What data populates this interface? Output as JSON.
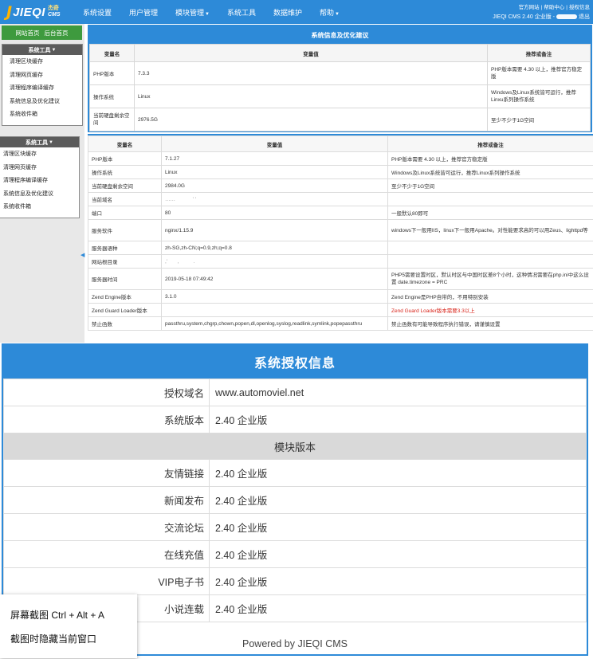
{
  "header": {
    "logo": {
      "letter": "J",
      "name": "JIEQI",
      "sub_cn": "杰奇",
      "sub_en": "CMS"
    },
    "nav": [
      {
        "label": "系统设置",
        "dropdown": false
      },
      {
        "label": "用户管理",
        "dropdown": false
      },
      {
        "label": "模块管理",
        "dropdown": true
      },
      {
        "label": "系统工具",
        "dropdown": false
      },
      {
        "label": "数据维护",
        "dropdown": false
      },
      {
        "label": "帮助",
        "dropdown": true
      }
    ],
    "top_links": [
      "官方网站",
      "帮助中心",
      "授权信息"
    ],
    "version_text": "JIEQI CMS 2.40 企业版 -",
    "logout": "退出"
  },
  "sidebar": {
    "home_links": [
      "网站首页",
      "后台首页"
    ],
    "panel_title": "系统工具",
    "items": [
      "清理区块缓存",
      "清理网页缓存",
      "清理程序编译缓存",
      "系统信息及优化建议",
      "系统收件箱"
    ],
    "panel2_title": "系统工具",
    "items2": [
      "清理区块缓存",
      "清理网页缓存",
      "清理程序编译缓存",
      "系统信息及优化建议",
      "系统收件箱"
    ]
  },
  "table1": {
    "title": "系统信息及优化建议",
    "headers": [
      "变量名",
      "变量值",
      "推荐或备注"
    ],
    "rows": [
      {
        "name": "PHP版本",
        "value": "7.3.3",
        "note": "PHP版本需要 4.30 以上，推荐官方稳定版"
      },
      {
        "name": "操作系统",
        "value": "Linux",
        "note": "Windows及Linux系统皆可运行，推荐Linxu系列操作系统"
      },
      {
        "name": "当前硬盘剩余空间",
        "value": "2976.5G",
        "note": "至少不少于1G空间"
      }
    ]
  },
  "table2": {
    "headers": [
      "变量名",
      "变量值",
      "推荐或备注"
    ],
    "rows": [
      {
        "name": "PHP版本",
        "value": "7.1.27",
        "note": "PHP版本需要 4.30 以上，推荐官方稳定版"
      },
      {
        "name": "操作系统",
        "value": "Linux",
        "note": "Windows及Linux系统皆可运行，推荐Linux系列操作系统"
      },
      {
        "name": "当前硬盘剩余空间",
        "value": "2984.0G",
        "note": "至少不少于1G空间"
      },
      {
        "name": "当前域名",
        "value": "",
        "note": ""
      },
      {
        "name": "端口",
        "value": "80",
        "note": "一般默认80即可"
      },
      {
        "name": "服务软件",
        "value": "nginx/1.15.9",
        "note": "windows下一般用IIS，linux下一般用Apache。对性能要求高的可以用Zeus、lighttpd等"
      },
      {
        "name": "服务器语种",
        "value": "zh-SG,zh-CN;q=0.9,zh;q=0.8",
        "note": ""
      },
      {
        "name": "网站根目录",
        "value": "",
        "note": ""
      },
      {
        "name": "服务器时间",
        "value": "2019-05-18 07:49:42",
        "note": "PHP5需要设置时区，默认时区与中国时区差8个小时，这种情况需要在php.ini中这么设置 date.timezone = PRC"
      },
      {
        "name": "Zend Engine版本",
        "value": "3.1.0",
        "note": "Zend Engine是PHP自带的，不用特别安装"
      },
      {
        "name": "Zend Guard Loader版本",
        "value": "",
        "note": "Zend Guard Loader版本需要3.3以上"
      },
      {
        "name": "禁止函数",
        "value": "passthru,system,chgrp,chown,popen,dl,openlog,syslog,readlink,symlink,popepassthru",
        "note": "禁止函数有可能导致程序执行错误，请谨慎设置"
      }
    ]
  },
  "auth": {
    "title": "系统授权信息",
    "rows": [
      {
        "label": "授权域名",
        "value": "www.automoviel.net"
      },
      {
        "label": "系统版本",
        "value": "2.40 企业版"
      }
    ],
    "module_section": "模块版本",
    "modules": [
      {
        "label": "友情链接",
        "value": "2.40 企业版"
      },
      {
        "label": "新闻发布",
        "value": "2.40 企业版"
      },
      {
        "label": "交流论坛",
        "value": "2.40 企业版"
      },
      {
        "label": "在线充值",
        "value": "2.40 企业版"
      },
      {
        "label": "VIP电子书",
        "value": "2.40 企业版"
      },
      {
        "label": "小说连载",
        "value": "2.40 企业版"
      }
    ],
    "footer": "Powered by JIEQI CMS"
  },
  "popup": {
    "items": [
      "屏幕截图 Ctrl + Alt + A",
      "截图时隐藏当前窗口"
    ]
  },
  "colors": {
    "accent": "#2d8ad8",
    "home_green": "#3e9a3e",
    "warning_red": "#d9261c"
  }
}
